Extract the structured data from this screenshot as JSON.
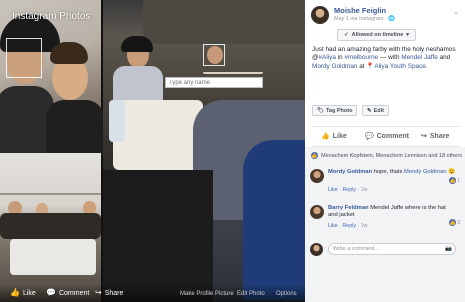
{
  "viewer": {
    "overlay_title": "Instagram Photos",
    "tag_input_placeholder": "Type any name",
    "actions": {
      "like": "Like",
      "comment": "Comment",
      "share": "Share"
    },
    "options": {
      "make_profile": "Make Profile Picture",
      "edit_photo": "Edit Photo",
      "options": "Options"
    }
  },
  "post": {
    "author": "Moishe Feiglin",
    "meta": "May 1 via Instagram · ",
    "audience": "Allowed on timeline",
    "text_prefix": "Just had an amazing farby with the holy neshamos @",
    "text_tag1": "#Aliya",
    "text_mid1": " in ",
    "text_tag2": "#melbourne",
    "text_mid2": " — with ",
    "text_person1": "Mendel Jaffe",
    "text_mid3": " and ",
    "text_person2": "Mordy Goldman",
    "text_mid4": " at ",
    "text_place": "Aliya Youth Space",
    "text_end": ".",
    "tag_photo_label": "Tag Photo",
    "edit_label": "Edit",
    "actions": {
      "like": "Like",
      "comment": "Comment",
      "share": "Share"
    }
  },
  "reactions": {
    "text": "Menachem Kopfstein, Menachem Lennison and 18 others"
  },
  "comments": [
    {
      "name": "Mordy Goldman",
      "text": " hope, thats ",
      "mention": "Mendy Goldman",
      "emoji": "😉",
      "like": "Like",
      "reply": "Reply",
      "time": "1w",
      "likes": "1"
    },
    {
      "name": "Barry Feldman",
      "text": " Mendel Jaffe where is the hat and jacket",
      "like": "Like",
      "reply": "Reply",
      "time": "1w",
      "likes": "3"
    }
  ],
  "write_comment_placeholder": "Write a comment...",
  "colors": {
    "link": "#385898",
    "fb_blue": "#4267b2"
  }
}
